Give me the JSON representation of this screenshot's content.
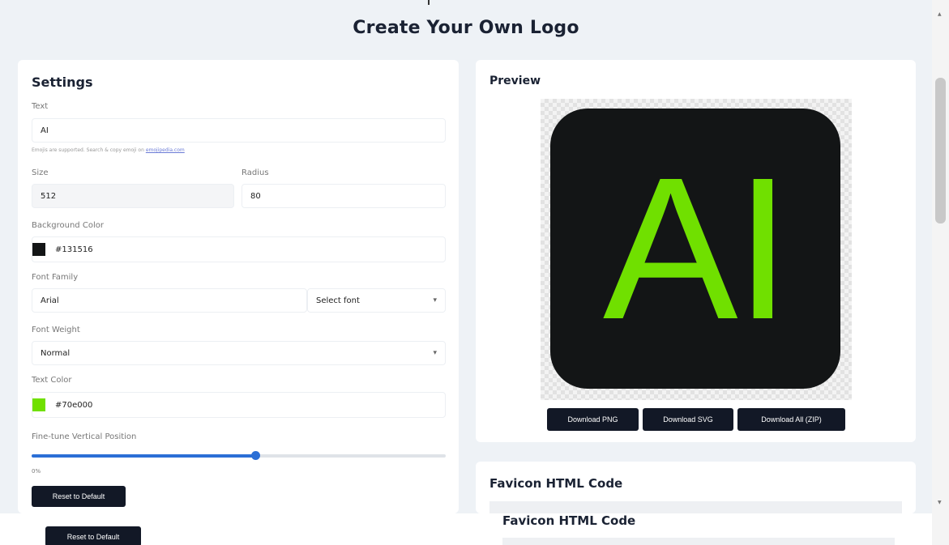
{
  "page": {
    "title": "Create Your Own Logo"
  },
  "settings": {
    "title": "Settings",
    "text_label": "Text",
    "text_value": "AI",
    "emoji_hint": "Emojis are supported. Search & copy emoji on",
    "emoji_hint_link": "emojipedia.com",
    "size_label": "Size",
    "size_value": "512",
    "radius_label": "Radius",
    "radius_value": "80",
    "bg_color_label": "Background Color",
    "bg_color_value": "#131516",
    "font_family_label": "Font Family",
    "font_family_value": "Arial",
    "select_font_label": "Select font",
    "font_weight_label": "Font Weight",
    "font_weight_value": "Normal",
    "text_color_label": "Text Color",
    "text_color_value": "#70e000",
    "vertical_position_label": "Fine-tune Vertical Position",
    "vertical_position_value": "0%",
    "vertical_position_fraction": 0.54,
    "reset_label": "Reset to Default"
  },
  "preview": {
    "title": "Preview",
    "logo_text": "AI",
    "logo_bg_color": "#131516",
    "logo_text_color": "#70e000",
    "download_png_label": "Download PNG",
    "download_svg_label": "Download SVG",
    "download_all_label": "Download All (ZIP)"
  },
  "favicon": {
    "title": "Favicon HTML Code"
  },
  "overlay": {
    "reset_label": "Reset to Default",
    "favicon_title": "Favicon HTML Code"
  },
  "icons": {
    "dropdown": "chevron-down-icon",
    "scroll_up": "triangle-up-icon",
    "scroll_down": "triangle-down-icon"
  }
}
